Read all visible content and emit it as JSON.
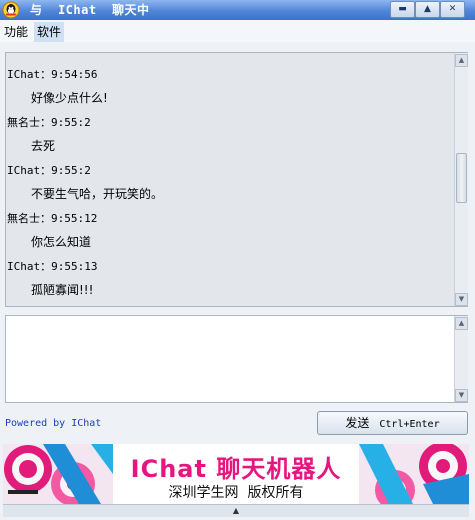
{
  "window": {
    "title": "与  IChat  聊天中",
    "controls": {
      "minimize": "▬",
      "maximize": "▲",
      "close": "✕"
    },
    "accent_color": "#4f86d8"
  },
  "menu": {
    "items": [
      "功能",
      "软件"
    ]
  },
  "chat": {
    "messages": [
      {
        "sender": "IChat：9:54:56",
        "text": "好像少点什么!"
      },
      {
        "sender": "無名士：9:55:2",
        "text": "去死"
      },
      {
        "sender": "IChat：9:55:2",
        "text": "不要生气哈，开玩笑的。"
      },
      {
        "sender": "無名士：9:55:12",
        "text": "你怎么知道"
      },
      {
        "sender": "IChat：9:55:13",
        "text": "孤陋寡闻!!!"
      }
    ]
  },
  "input": {
    "value": ""
  },
  "footer": {
    "powered_by": "Powered by IChat",
    "send_label": "发送",
    "send_shortcut": "Ctrl+Enter"
  },
  "banner": {
    "title": "IChat 聊天机器人",
    "subtitle": "深圳学生网  版权所有",
    "title_color": "#e6157f"
  },
  "bottom_bar": {
    "arrow": "▲"
  }
}
